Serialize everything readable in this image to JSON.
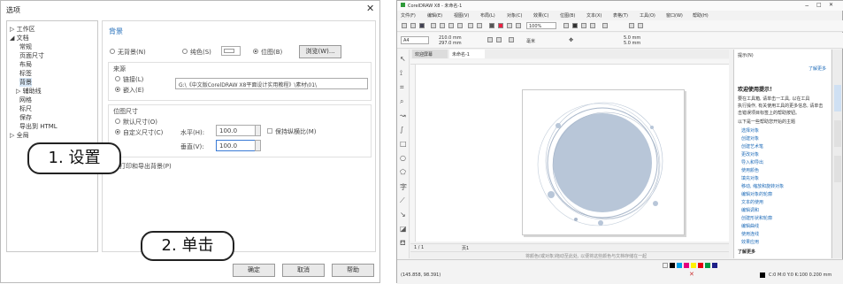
{
  "dialog": {
    "title": "选项",
    "close": "✕",
    "tree": [
      "▷ 工作区",
      "◢ 文档",
      "常规",
      "页面尺寸",
      "布局",
      "标签",
      "背景",
      "▷ 辅助线",
      "网格",
      "标尺",
      "保存",
      "导出到 HTML",
      "▷ 全局"
    ],
    "section_title": "背景",
    "no_bg": "无背景(N)",
    "solid": "纯色(S)",
    "bitmap": "位图(B)",
    "browse": "浏览(W)...",
    "source_label": "来源",
    "link": "链接(L)",
    "embed": "嵌入(E)",
    "path": "G:\\《中文版CorelDRAW X8平面设计实用教程》\\素材\\01\\",
    "size_label": "位图尺寸",
    "default_size": "默认尺寸(O)",
    "custom_size": "自定义尺寸(C)",
    "h_label": "水平(H):",
    "h_value": "100.0",
    "keep_ratio": "保持纵横比(M)",
    "v_label": "垂直(V):",
    "v_value": "100.0",
    "print_export": "打印和导出背景(P)",
    "ok": "确定",
    "cancel": "取消",
    "help": "帮助"
  },
  "callouts": {
    "step1": "1. 设置",
    "step2": "2. 单击"
  },
  "app": {
    "title": "CorelDRAW X8 - 未命名-1",
    "menus": [
      "文件(F)",
      "编辑(E)",
      "视图(V)",
      "布局(L)",
      "对象(C)",
      "效果(C)",
      "位图(B)",
      "文本(X)",
      "表格(T)",
      "工具(O)",
      "窗口(W)",
      "帮助(H)"
    ],
    "zoom": "100%",
    "paper": "A4",
    "width": "210.0 mm",
    "height": "297.0 mm",
    "unit": "毫米",
    "tabs": [
      "欢迎屏幕",
      "未命名-1"
    ],
    "page_tab": "页1",
    "page_counter": "1 / 1",
    "coords": "(145.858, 98.391)",
    "status_center": "将颜色(或对象)拖动至此处, 以便将这些颜色与文档存储在一起",
    "color_info": "C:0 M:0 Y:0 K:100  0.200 mm",
    "docker_title": "提示(N)",
    "docker_heading": "欢迎使用提示！",
    "docker_body": [
      "要在工具箱, 请单击一工具, 以在工具",
      "执行操作, 有关使用工具的更多信息, 请单击",
      "击错误项目标签上的帮助按钮。"
    ],
    "docker_prompt": "以下是一些帮助您开始的主题",
    "docker_links": [
      "选择对象",
      "创建对象",
      "创建艺术笔",
      "更改对象",
      "导入和导出",
      "使用颜色",
      "填充对象",
      "移动, 缩放和旋转对象",
      "编辑对象的轮廓",
      "文本的使用",
      "编辑调和",
      "创建形状和轮廓",
      "编辑曲线",
      "使用连线",
      "效果应用"
    ],
    "learn_more": "了解更多",
    "learn_link": "了解更多",
    "swatches": [
      "#ffffff",
      "#000000",
      "#00a0e9",
      "#e4007f",
      "#fff100",
      "#e60012",
      "#009944",
      "#1d2088"
    ]
  }
}
